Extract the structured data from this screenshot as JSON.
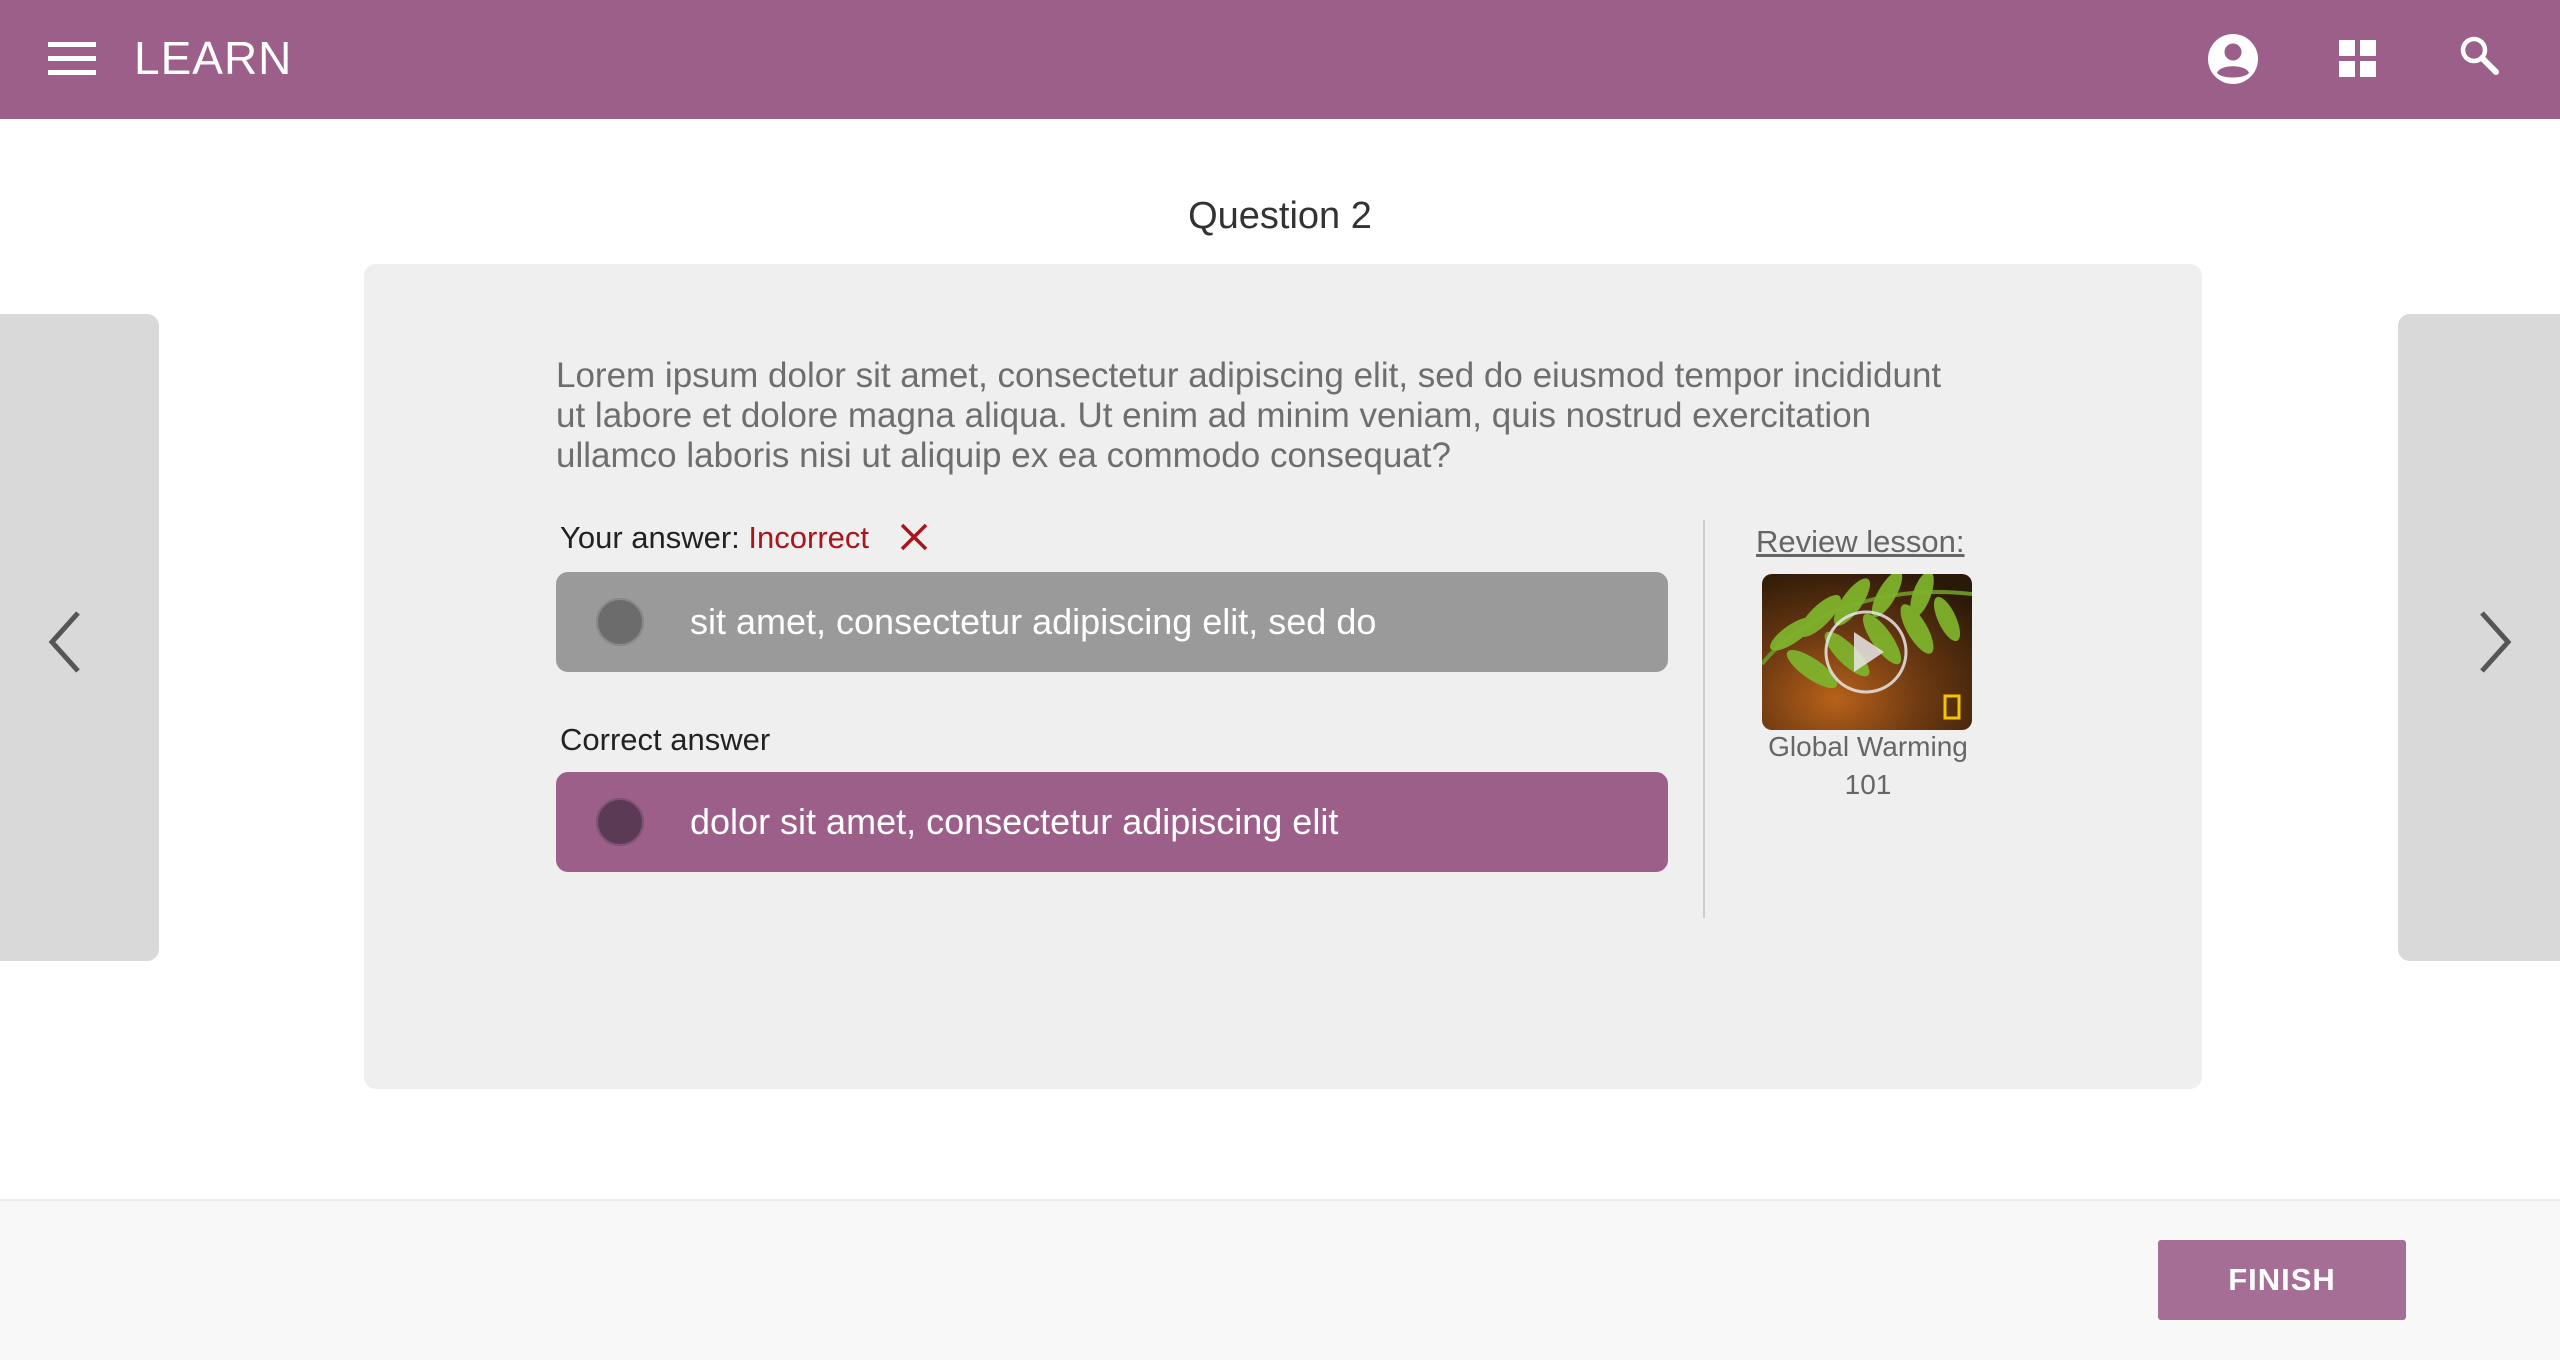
{
  "header": {
    "title": "LEARN",
    "icons": [
      "menu-icon",
      "account-icon",
      "apps-icon",
      "search-icon"
    ]
  },
  "question": {
    "heading": "Question 2",
    "text": "Lorem ipsum dolor sit amet, consectetur adipiscing elit, sed do eiusmod tempor incididunt ut labore et dolore magna aliqua. Ut enim ad minim veniam, quis nostrud exercitation ullamco laboris nisi ut aliquip ex ea commodo consequat?"
  },
  "your_answer": {
    "label": "Your answer:",
    "status": "Incorrect",
    "option_text": "sit amet, consectetur adipiscing elit, sed do"
  },
  "correct_answer": {
    "label": "Correct answer",
    "option_text": "dolor sit amet, consectetur adipiscing elit"
  },
  "review": {
    "label": "Review lesson:",
    "lesson_title": "Global Warming 101"
  },
  "footer": {
    "finish_label": "FINISH"
  },
  "colors": {
    "brand": "#9c5f89",
    "incorrect": "#a9151c",
    "your_answer_bg": "#9a9a9a",
    "card_bg": "#efefef"
  }
}
